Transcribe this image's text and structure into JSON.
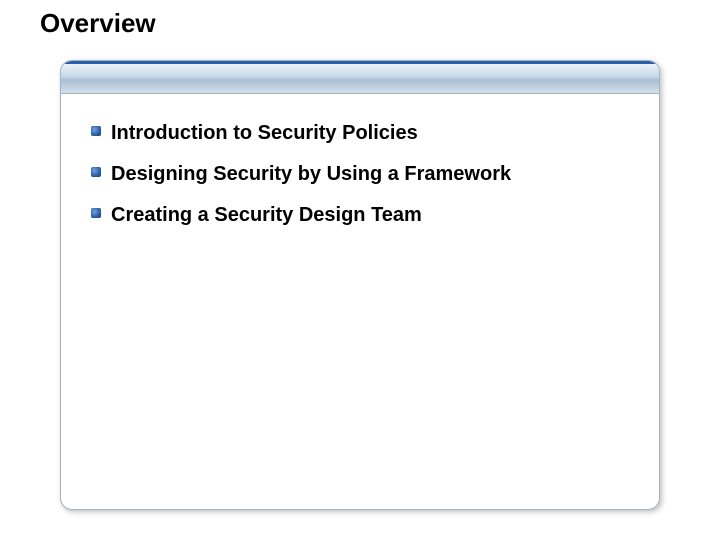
{
  "title": "Overview",
  "bullets": [
    {
      "text": "Introduction to Security Policies"
    },
    {
      "text": "Designing Security by Using a Framework"
    },
    {
      "text": "Creating a Security Design Team"
    }
  ]
}
